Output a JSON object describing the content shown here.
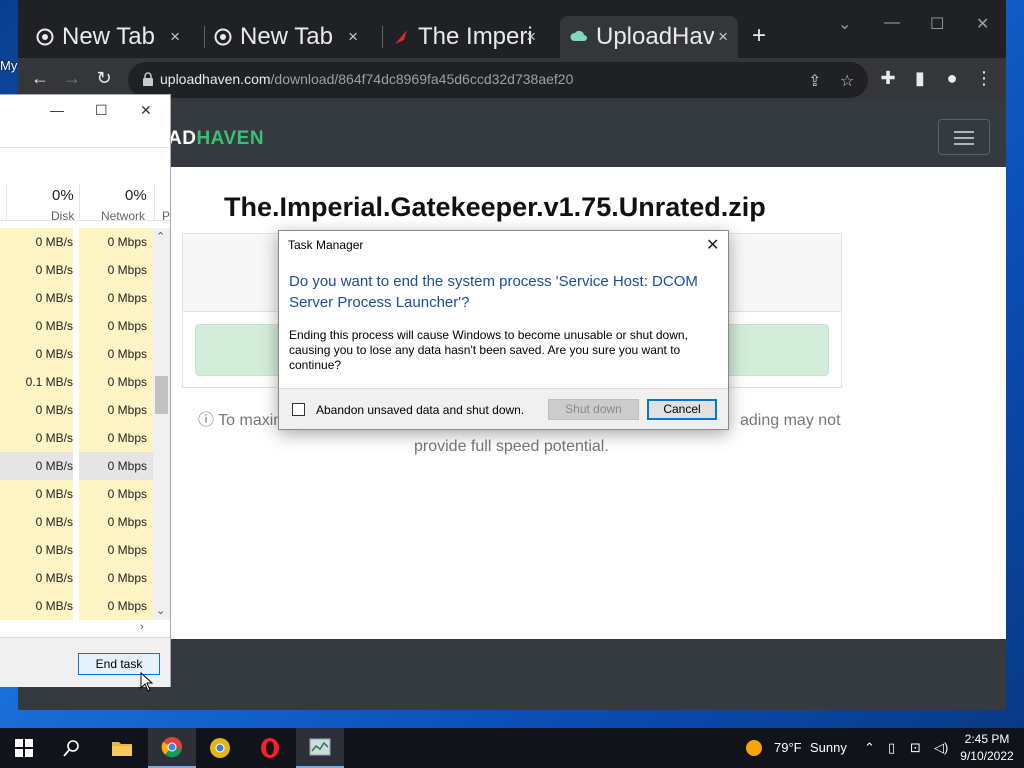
{
  "desktop": {
    "label": "My"
  },
  "browser": {
    "tabs": [
      {
        "title": "New Tab",
        "close": "×"
      },
      {
        "title": "New Tab",
        "close": "×"
      },
      {
        "title": "The Imperi",
        "close": "×"
      },
      {
        "title": "UploadHav",
        "close": "×"
      }
    ],
    "new_tab": "+",
    "window_controls": {
      "dropdown": "⌄",
      "minimize": "—",
      "maximize": "☐",
      "close": "✕"
    },
    "url_host": "uploadhaven.com",
    "url_path": "/download/864f74dc8969fa45d6ccd32d738aef20"
  },
  "site": {
    "logo_a": "AD",
    "logo_b": "HAVEN",
    "file_title": "The.Imperial.Gatekeeper.v1.75.Unrated.zip",
    "info_line1_start": "To maxim",
    "info_line1_end": "ading may not",
    "info_line2": "provide full speed potential."
  },
  "taskmgr": {
    "disk_pct": "0%",
    "disk_label": "Disk",
    "net_pct": "0%",
    "net_label": "Network",
    "extra_col": "P",
    "rows": [
      {
        "disk": "0 MB/s",
        "net": "0 Mbps"
      },
      {
        "disk": "0 MB/s",
        "net": "0 Mbps"
      },
      {
        "disk": "0 MB/s",
        "net": "0 Mbps"
      },
      {
        "disk": "0 MB/s",
        "net": "0 Mbps"
      },
      {
        "disk": "0 MB/s",
        "net": "0 Mbps"
      },
      {
        "disk": "0.1 MB/s",
        "net": "0 Mbps"
      },
      {
        "disk": "0 MB/s",
        "net": "0 Mbps"
      },
      {
        "disk": "0 MB/s",
        "net": "0 Mbps"
      },
      {
        "disk": "0 MB/s",
        "net": "0 Mbps"
      },
      {
        "disk": "0 MB/s",
        "net": "0 Mbps"
      },
      {
        "disk": "0 MB/s",
        "net": "0 Mbps"
      },
      {
        "disk": "0 MB/s",
        "net": "0 Mbps"
      },
      {
        "disk": "0 MB/s",
        "net": "0 Mbps"
      },
      {
        "disk": "0 MB/s",
        "net": "0 Mbps"
      }
    ],
    "end_task": "End task"
  },
  "dialog": {
    "title": "Task Manager",
    "question": "Do you want to end the system process 'Service Host: DCOM Server Process Launcher'?",
    "body": "Ending this process will cause Windows to become unusable or shut down, causing you to lose any data hasn't been saved. Are you sure you want to continue?",
    "checkbox_label": "Abandon unsaved data and shut down.",
    "shutdown_label": "Shut down",
    "cancel_label": "Cancel"
  },
  "taskbar": {
    "weather_temp": "79°F",
    "weather_desc": "Sunny",
    "time": "2:45 PM",
    "date": "9/10/2022"
  },
  "colors": {
    "accent": "#0078d7",
    "brand_green": "#38c172",
    "question_blue": "#1b4da0"
  }
}
